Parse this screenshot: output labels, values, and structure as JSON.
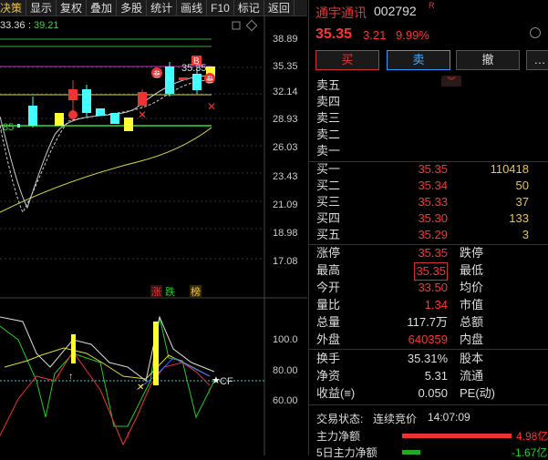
{
  "menu": [
    "决策",
    "显示",
    "复权",
    "叠加",
    "多股",
    "统计",
    "画线",
    "F10",
    "标记",
    "返回"
  ],
  "indicator_bar": {
    "a": "33.36",
    "sep": ":",
    "b": "39.21"
  },
  "kline": {
    "price_labels": [
      "38.89",
      "35.35",
      "32.14",
      "28.93",
      "26.03",
      "23.43",
      "21.09",
      "18.98",
      "17.08"
    ],
    "marker_price": "35.35",
    "left_value": ".85",
    "badges": [
      "涨",
      "跌",
      "榜"
    ],
    "markers": {
      "B": "B",
      "san": "叁"
    }
  },
  "sub": {
    "labels": [
      "100.0",
      "80.00",
      "60.00"
    ],
    "cf": "CF"
  },
  "quote": {
    "name": "通宇通讯",
    "code": "002792",
    "r": "R",
    "price": "35.35",
    "change": "3.21",
    "pct": "9.99%",
    "buttons": {
      "buy": "买",
      "sell": "卖",
      "cancel": "撤",
      "more": "…"
    },
    "collapse": "︾",
    "asks": [
      {
        "label": "卖五",
        "price": "",
        "vol": ""
      },
      {
        "label": "卖四",
        "price": "",
        "vol": ""
      },
      {
        "label": "卖三",
        "price": "",
        "vol": ""
      },
      {
        "label": "卖二",
        "price": "",
        "vol": ""
      },
      {
        "label": "卖一",
        "price": "",
        "vol": ""
      }
    ],
    "bids": [
      {
        "label": "买一",
        "price": "35.35",
        "vol": "110418"
      },
      {
        "label": "买二",
        "price": "35.34",
        "vol": "50"
      },
      {
        "label": "买三",
        "price": "35.33",
        "vol": "37"
      },
      {
        "label": "买四",
        "price": "35.30",
        "vol": "133"
      },
      {
        "label": "买五",
        "price": "35.29",
        "vol": "3"
      }
    ],
    "stats": [
      {
        "l": "涨停",
        "v": "35.35",
        "l2": "跌停",
        "v2": ""
      },
      {
        "l": "最高",
        "v": "35.35",
        "l2": "最低",
        "v2": ""
      },
      {
        "l": "今开",
        "v": "33.50",
        "l2": "均价",
        "v2": ""
      },
      {
        "l": "量比",
        "v": "1.34",
        "l2": "市值",
        "v2": ""
      },
      {
        "l": "总量",
        "v": "117.7万",
        "l2": "总额",
        "v2": ""
      },
      {
        "l": "外盘",
        "v": "640359",
        "l2": "内盘",
        "v2": ""
      }
    ],
    "stats2": [
      {
        "l": "换手",
        "v": "35.31%",
        "l2": "股本",
        "v2": ""
      },
      {
        "l": "净资",
        "v": "5.31",
        "l2": "流通",
        "v2": ""
      },
      {
        "l": "收益(≡)",
        "v": "0.050",
        "l2": "PE(动)",
        "v2": ""
      }
    ],
    "status_label": "交易状态:",
    "status": "连续竞价",
    "time": "14:07:09",
    "main_net_label": "主力净额",
    "main_net": "4.98亿",
    "five_day_label": "5日主力净额",
    "five_day": "-1.67亿"
  }
}
